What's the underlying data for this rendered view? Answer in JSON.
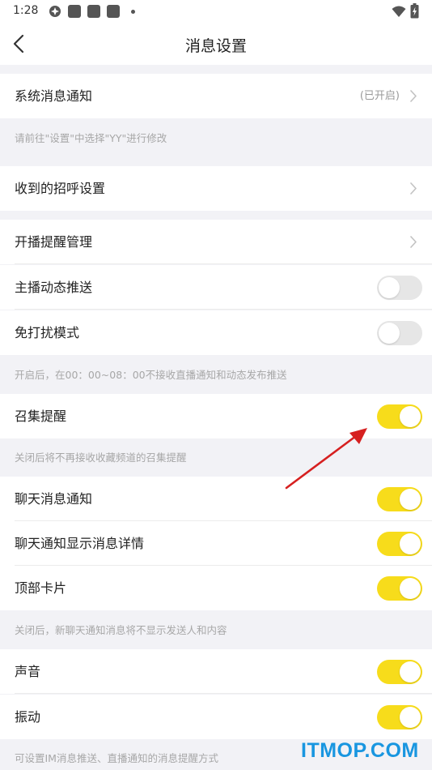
{
  "status_bar": {
    "time": "1:28",
    "icons": [
      "app-icon",
      "notification-square-icon",
      "notification-square-icon",
      "notification-square-icon",
      "dot-icon",
      "wifi-icon",
      "battery-charging-icon"
    ]
  },
  "nav": {
    "title": "消息设置",
    "back_icon": "chevron-left-icon"
  },
  "sections": {
    "system": {
      "label": "系统消息通知",
      "status": "(已开启)",
      "hint": "请前往\"设置\"中选择\"YY\"进行修改"
    },
    "greeting": {
      "label": "收到的招呼设置"
    },
    "broadcast": {
      "start_label": "开播提醒管理",
      "anchor_label": "主播动态推送",
      "anchor_on": false,
      "dnd_label": "免打扰模式",
      "dnd_on": false,
      "hint": "开启后，在00：00~08：00不接收直播通知和动态发布推送"
    },
    "gather": {
      "label": "召集提醒",
      "on": true,
      "hint": "关闭后将不再接收收藏频道的召集提醒"
    },
    "chat": {
      "notify_label": "聊天消息通知",
      "notify_on": true,
      "detail_label": "聊天通知显示消息详情",
      "detail_on": true,
      "card_label": "顶部卡片",
      "card_on": true,
      "hint": "关闭后，新聊天通知消息将不显示发送人和内容"
    },
    "sound": {
      "sound_label": "声音",
      "sound_on": true,
      "vibrate_label": "振动",
      "vibrate_on": true,
      "hint": "可设置IM消息推送、直播通知的消息提醒方式"
    }
  },
  "watermark": "ITMOP.COM",
  "colors": {
    "toggle_on": "#f7dc1b",
    "toggle_off": "#e6e6e6",
    "background": "#f2f2f6",
    "arrow": "#d62020",
    "watermark": "#1996e0"
  }
}
